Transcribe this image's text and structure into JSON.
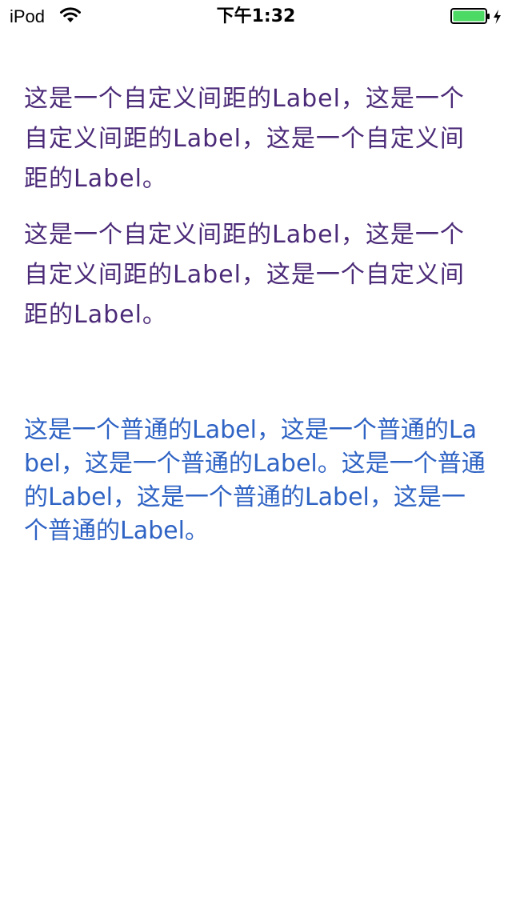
{
  "status_bar": {
    "carrier": "iPod",
    "time": "下午1:32",
    "wifi_icon": "wifi-icon",
    "battery_icon": "battery-charging-icon",
    "battery_color": "#4cd964"
  },
  "content": {
    "custom_label_1": "这是一个自定义间距的Label，这是一个自定义间距的Label，这是一个自定义间距的Label。",
    "custom_label_2": "这是一个自定义间距的Label，这是一个自定义间距的Label，这是一个自定义间距的Label。",
    "normal_label_1": "这是一个普通的Label，这是一个普通的Label，这是一个普通的Label。这是一个普通的Label，这是一个普通的Label，这是一个普通的Label。",
    "custom_color": "#4b2a78",
    "normal_color": "#2f63c4"
  }
}
